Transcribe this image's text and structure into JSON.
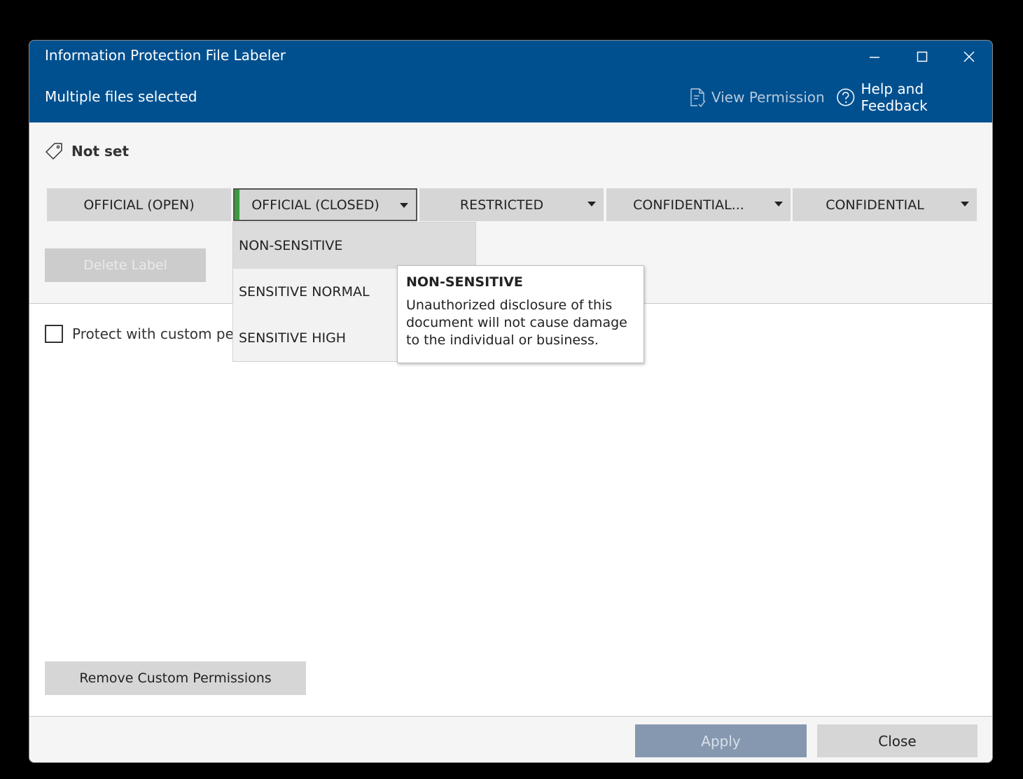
{
  "window": {
    "title": "Information Protection File Labeler",
    "subtitle": "Multiple files selected",
    "controls": [
      "minimize-icon",
      "maximize-icon",
      "close-icon"
    ]
  },
  "header_actions": {
    "view_permission": "View Permission",
    "help_feedback": "Help and Feedback"
  },
  "current_label": {
    "icon": "tag-icon",
    "text": "Not set"
  },
  "labels": [
    {
      "text": "OFFICIAL (OPEN)",
      "has_dropdown": false
    },
    {
      "text": "OFFICIAL (CLOSED)",
      "has_dropdown": true,
      "selected": true
    },
    {
      "text": "RESTRICTED",
      "has_dropdown": true
    },
    {
      "text": "CONFIDENTIAL...",
      "has_dropdown": true
    },
    {
      "text": "CONFIDENTIAL",
      "has_dropdown": true
    }
  ],
  "delete_label": "Delete Label",
  "protect_custom": {
    "label": "Protect with custom per",
    "checked": false
  },
  "dropdown": {
    "items": [
      "NON-SENSITIVE",
      "SENSITIVE NORMAL",
      "SENSITIVE HIGH"
    ],
    "hovered_index": 0
  },
  "tooltip": {
    "title": "NON-SENSITIVE",
    "body": "Unauthorized disclosure of this document will not cause damage to the individual or business."
  },
  "remove_custom_permissions": "Remove Custom Permissions",
  "footer": {
    "apply": "Apply",
    "close": "Close"
  },
  "colors": {
    "titlebar": "#00508f",
    "selected_indicator": "#3a9b3f",
    "apply_disabled": "#8598af"
  }
}
